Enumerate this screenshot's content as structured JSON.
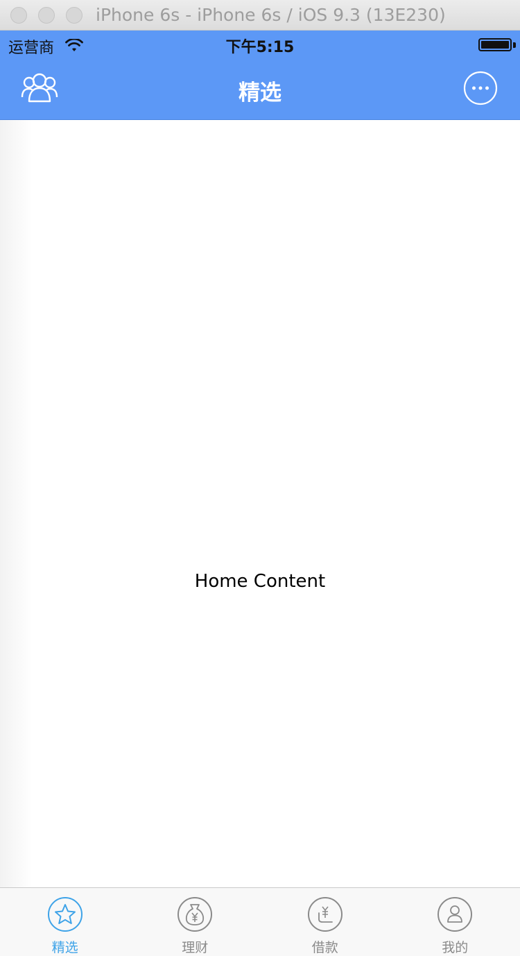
{
  "window": {
    "title": "iPhone 6s - iPhone 6s / iOS 9.3 (13E230)"
  },
  "status_bar": {
    "carrier": "运营商",
    "time": "下午5:15",
    "wifi_icon": "wifi-icon",
    "battery_icon": "battery-icon"
  },
  "navbar": {
    "title": "精选",
    "left_icon": "people-group-icon",
    "right_icon": "more-dots-icon",
    "background": "#5c98f6"
  },
  "content": {
    "text": "Home Content"
  },
  "tabbar": {
    "active_color": "#3ea3e8",
    "inactive_color": "#8a8a8a",
    "items": [
      {
        "label": "精选",
        "icon": "star-icon",
        "active": true
      },
      {
        "label": "理财",
        "icon": "money-bag-icon",
        "active": false
      },
      {
        "label": "借款",
        "icon": "loan-icon",
        "active": false
      },
      {
        "label": "我的",
        "icon": "user-icon",
        "active": false
      }
    ]
  }
}
